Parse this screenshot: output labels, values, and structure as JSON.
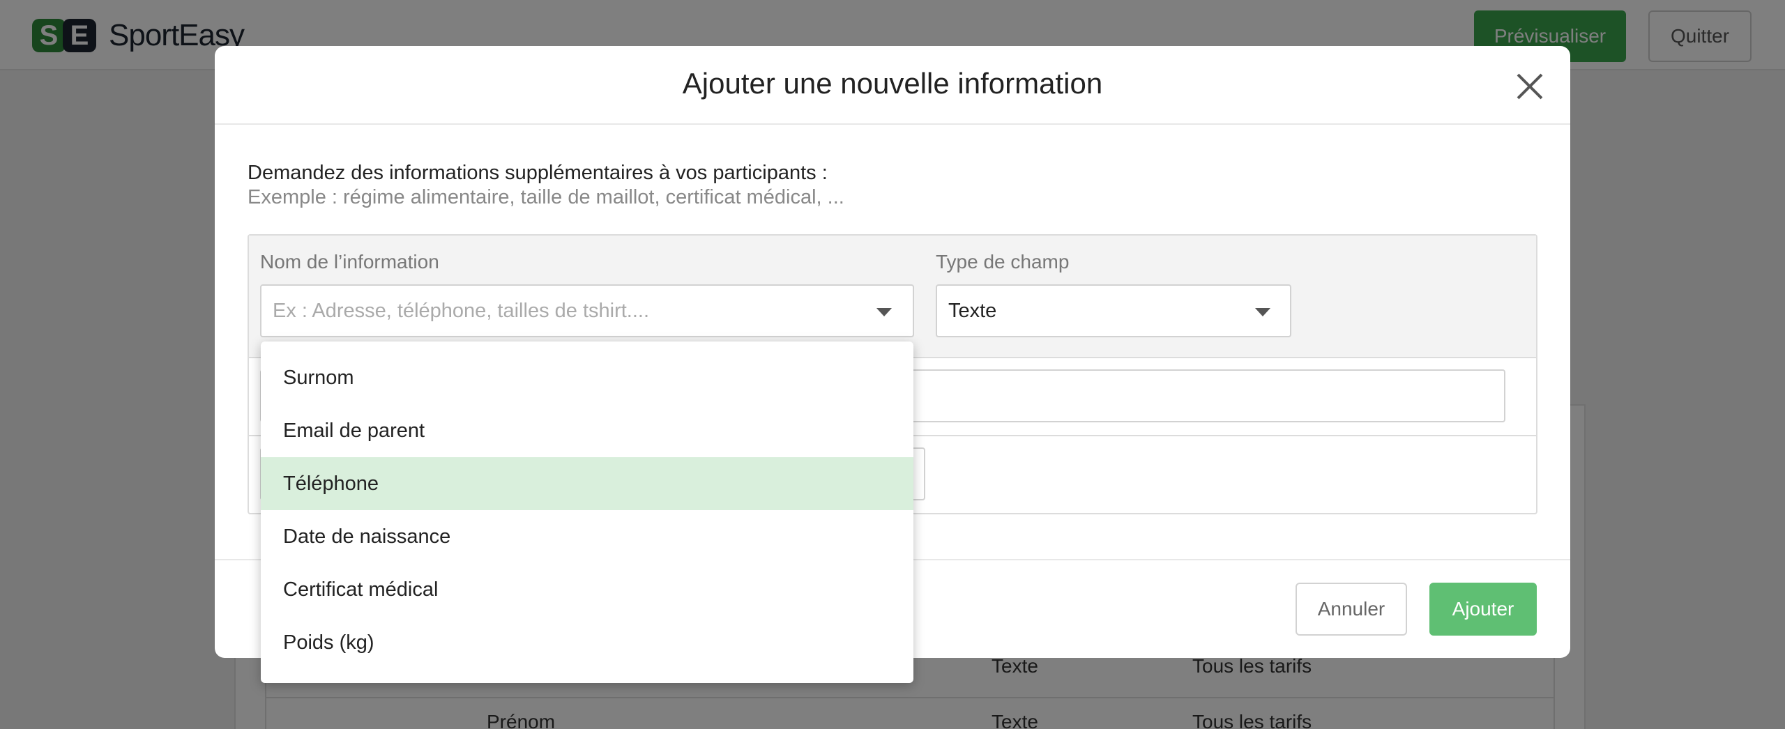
{
  "app": {
    "brand": "SportEasy",
    "logo_letters": [
      "S",
      "E"
    ],
    "preview_label": "Prévisualiser",
    "quit_label": "Quitter",
    "colors": {
      "accent": "#3aa54d",
      "accent_light": "#5fbf73",
      "highlight": "#d9efdc"
    }
  },
  "background_table": {
    "rows": [
      {
        "type": "Texte",
        "rates": "Tous les tarifs"
      },
      {
        "name": "Prénom",
        "type": "Texte",
        "rates": "Tous les tarifs"
      }
    ]
  },
  "modal": {
    "title": "Ajouter une nouvelle information",
    "intro": "Demandez des informations supplémentaires à vos participants :",
    "example": "Exemple : régime alimentaire, taille de maillot, certificat médical, ...",
    "name_label": "Nom de l’information",
    "name_placeholder": "Ex : Adresse, téléphone, tailles de tshirt....",
    "type_label": "Type de champ",
    "type_value": "Texte",
    "cancel_label": "Annuler",
    "add_label": "Ajouter"
  },
  "dropdown": {
    "options": [
      "Surnom",
      "Email de parent",
      "Téléphone",
      "Date de naissance",
      "Certificat médical",
      "Poids (kg)"
    ],
    "highlighted": "Téléphone"
  }
}
